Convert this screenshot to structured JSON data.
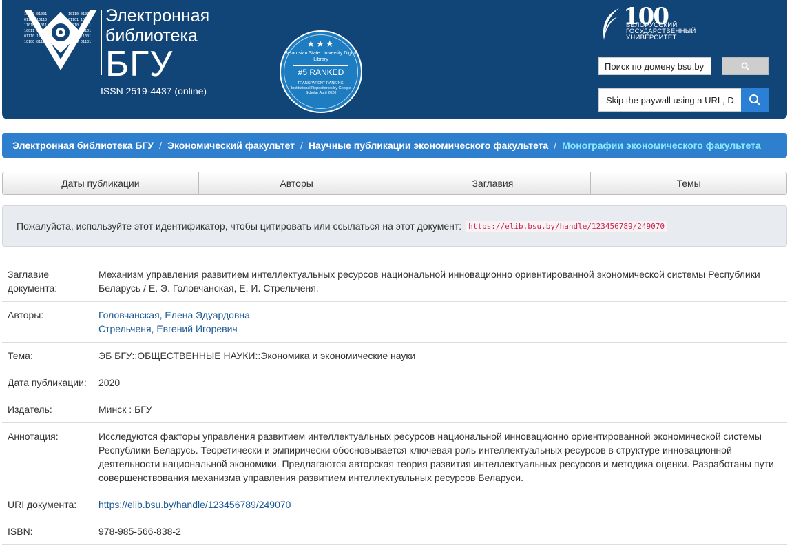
{
  "header": {
    "title_line1": "Электронная",
    "title_line2": "библиотека",
    "title_big": "БГУ",
    "issn": "ISSN 2519-4437 (online)",
    "badge": {
      "stars": "★★★",
      "line1": "Belarusian State University Digital Library",
      "rank": "#5 RANKED",
      "line3": "TRANSPARENT RANKING: Institutional Repositories by Google Scholar April 2020"
    },
    "bsu_logo": {
      "number": "100",
      "line1": "БЕЛОРУССКИЙ",
      "line2": "ГОСУДАРСТВЕННЫЙ",
      "line3": "УНИВЕРСИТЕТ"
    },
    "search_domain_value": "Поиск по домену bsu.by",
    "search_url_value": "Skip the paywall using a URL, DOI"
  },
  "breadcrumb": [
    "Электронная библиотека БГУ",
    "Экономический факультет",
    "Научные публикации экономического факультета",
    "Монографии экономического факультета"
  ],
  "browse": [
    "Даты публикации",
    "Авторы",
    "Заглавия",
    "Темы"
  ],
  "citation": {
    "text": "Пожалуйста, используйте этот идентификатор, чтобы цитировать или ссылаться на этот документ:",
    "url": "https://elib.bsu.by/handle/123456789/249070"
  },
  "metadata": {
    "title_label": "Заглавие документа:",
    "title_value": "Механизм управления развитием интеллектуальных ресурсов национальной инновационно ориентированной экономической системы Республики Беларусь / Е. Э. Головчанская, Е. И. Стрельченя.",
    "authors_label": "Авторы:",
    "author1": "Головчанская, Елена Эдуардовна",
    "author2": "Стрельченя, Евгений Игоревич",
    "subject_label": "Тема:",
    "subject_value": "ЭБ БГУ::ОБЩЕСТВЕННЫЕ НАУКИ::Экономика и экономические науки",
    "date_label": "Дата публикации:",
    "date_value": "2020",
    "publisher_label": "Издатель:",
    "publisher_value": "Минск : БГУ",
    "abstract_label": "Аннотация:",
    "abstract_value": "Исследуются факторы управления развитием интеллектуальных ресурсов национальной инновационно ориентированной экономической системы Республики Беларусь. Теоретически и эмпирически обосновывается ключевая роль интеллектуальных ресурсов в структуре инновационной деятельности национальной экономики. Предлагаются авторская теория развития интеллектуальных ресурсов и методика оценки. Разработаны пути совершенствования механизма управления развитием интеллектуальных ресурсов Беларуси.",
    "uri_label": "URI документа:",
    "uri_value": "https://elib.bsu.by/handle/123456789/249070",
    "isbn_label": "ISBN:",
    "isbn_value": "978-985-566-838-2"
  },
  "colors": {
    "header_bg": "#124577",
    "breadcrumb_bg": "#2f7fcf",
    "breadcrumb_active": "#8be9ff",
    "link": "#1c5a96"
  },
  "icons": [
    "library-logo-icon",
    "search-icon"
  ]
}
